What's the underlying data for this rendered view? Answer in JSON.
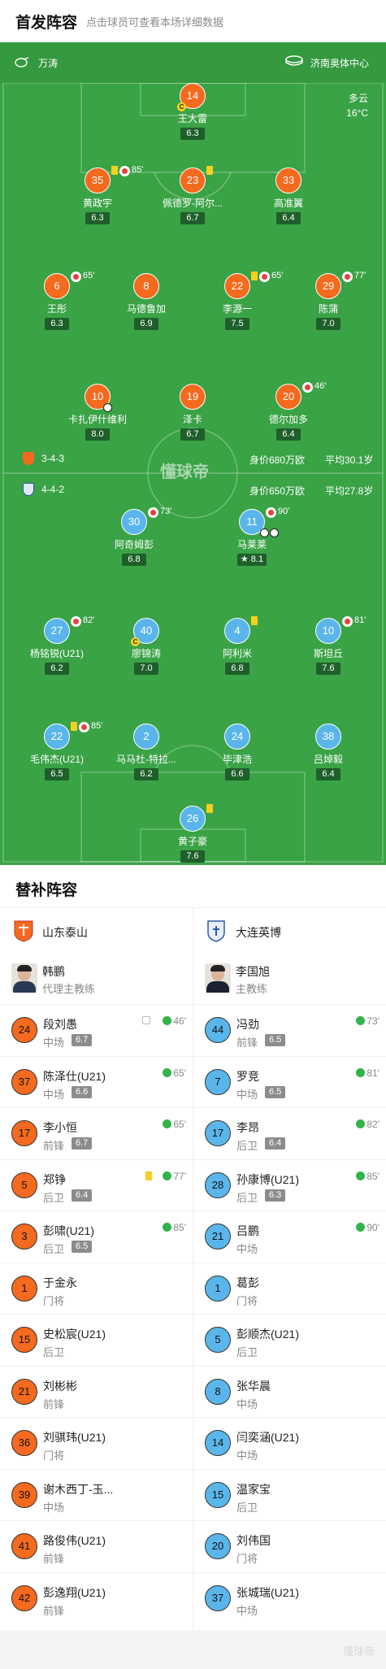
{
  "header": {
    "title": "首发阵容",
    "subtitle": "点击球员可查看本场详细数据"
  },
  "pitch_info": {
    "referee": "万涛",
    "venue": "济南奥体中心",
    "weather": "多云",
    "temperature": "16°C",
    "watermark": "懂球帝"
  },
  "home_team": {
    "name": "山东泰山",
    "formation": "3-4-3",
    "value": "身价680万欧",
    "avg_age": "平均30.1岁",
    "color": "#f46a1e"
  },
  "away_team": {
    "name": "大连英博",
    "formation": "4-4-2",
    "value": "身价650万欧",
    "avg_age": "平均27.8岁",
    "color": "#5ab6ea"
  },
  "home_lineup": [
    {
      "num": "14",
      "name": "王大雷",
      "rating": "6.3",
      "captain": true
    },
    {
      "num": "35",
      "name": "黄政宇",
      "rating": "6.3",
      "yellow": true,
      "sub_out": "85'"
    },
    {
      "num": "23",
      "name": "佩德罗-阿尔...",
      "rating": "6.7",
      "yellow": true
    },
    {
      "num": "33",
      "name": "高准翼",
      "rating": "6.4"
    },
    {
      "num": "6",
      "name": "王彤",
      "rating": "6.3",
      "sub_out": "65'"
    },
    {
      "num": "8",
      "name": "马德鲁加",
      "rating": "6.9"
    },
    {
      "num": "22",
      "name": "李源一",
      "rating": "7.5",
      "yellow": true,
      "sub_out": "65'"
    },
    {
      "num": "29",
      "name": "陈蒲",
      "rating": "7.0",
      "sub_out": "77'"
    },
    {
      "num": "10",
      "name": "卡扎伊什维利",
      "rating": "8.0",
      "goal": true
    },
    {
      "num": "19",
      "name": "泽卡",
      "rating": "6.7"
    },
    {
      "num": "20",
      "name": "德尔加多",
      "rating": "6.4",
      "sub_out": "46'"
    }
  ],
  "away_lineup": [
    {
      "num": "30",
      "name": "阿奇姆彭",
      "rating": "6.8",
      "sub_out": "73'"
    },
    {
      "num": "11",
      "name": "马莱莱",
      "rating": "8.1",
      "sub_out": "90'",
      "goals": 2,
      "star": true
    },
    {
      "num": "27",
      "name": "杨铭锐(U21)",
      "rating": "6.2",
      "sub_out": "82'"
    },
    {
      "num": "40",
      "name": "廖锦涛",
      "rating": "7.0",
      "captain": true
    },
    {
      "num": "4",
      "name": "阿利米",
      "rating": "6.8",
      "yellow": true
    },
    {
      "num": "10",
      "name": "斯坦丘",
      "rating": "7.6",
      "sub_out": "81'"
    },
    {
      "num": "22",
      "name": "毛伟杰(U21)",
      "rating": "6.5",
      "yellow": true,
      "sub_out": "85'"
    },
    {
      "num": "2",
      "name": "马马杜-特拉...",
      "rating": "6.2"
    },
    {
      "num": "24",
      "name": "毕津浩",
      "rating": "6.6"
    },
    {
      "num": "38",
      "name": "吕焯毅",
      "rating": "6.4"
    },
    {
      "num": "26",
      "name": "黄子豪",
      "rating": "7.6",
      "yellow": true
    }
  ],
  "subs": {
    "title": "替补阵容",
    "home": {
      "team": "山东泰山",
      "coach": {
        "name": "韩鹏",
        "role": "代理主教练"
      },
      "players": [
        {
          "num": "24",
          "name": "段刘愚",
          "pos": "中场",
          "rating": "6.7",
          "in": "46'",
          "boot": true
        },
        {
          "num": "37",
          "name": "陈泽仕(U21)",
          "pos": "中场",
          "rating": "6.6",
          "in": "65'"
        },
        {
          "num": "17",
          "name": "李小恒",
          "pos": "前锋",
          "rating": "6.7",
          "in": "65'"
        },
        {
          "num": "5",
          "name": "郑铮",
          "pos": "后卫",
          "rating": "6.4",
          "in": "77'",
          "yellow": true
        },
        {
          "num": "3",
          "name": "彭啸(U21)",
          "pos": "后卫",
          "rating": "6.5",
          "in": "85'"
        },
        {
          "num": "1",
          "name": "于金永",
          "pos": "门将"
        },
        {
          "num": "15",
          "name": "史松宸(U21)",
          "pos": "后卫"
        },
        {
          "num": "21",
          "name": "刘彬彬",
          "pos": "前锋"
        },
        {
          "num": "36",
          "name": "刘骐玮(U21)",
          "pos": "门将"
        },
        {
          "num": "39",
          "name": "谢木西丁-玉...",
          "pos": "中场"
        },
        {
          "num": "41",
          "name": "路俊伟(U21)",
          "pos": "前锋"
        },
        {
          "num": "42",
          "name": "彭逸翔(U21)",
          "pos": "前锋"
        }
      ]
    },
    "away": {
      "team": "大连英博",
      "coach": {
        "name": "李国旭",
        "role": "主教练"
      },
      "players": [
        {
          "num": "44",
          "name": "冯劲",
          "pos": "前锋",
          "rating": "6.5",
          "in": "73'"
        },
        {
          "num": "7",
          "name": "罗竞",
          "pos": "中场",
          "rating": "6.5",
          "in": "81'"
        },
        {
          "num": "17",
          "name": "李昂",
          "pos": "后卫",
          "rating": "6.4",
          "in": "82'"
        },
        {
          "num": "28",
          "name": "孙康博(U21)",
          "pos": "后卫",
          "rating": "6.3",
          "in": "85'"
        },
        {
          "num": "21",
          "name": "吕鹏",
          "pos": "中场",
          "in": "90'"
        },
        {
          "num": "1",
          "name": "葛彭",
          "pos": "门将"
        },
        {
          "num": "5",
          "name": "彭顺杰(U21)",
          "pos": "后卫"
        },
        {
          "num": "8",
          "name": "张华晨",
          "pos": "中场"
        },
        {
          "num": "14",
          "name": "闫奕涵(U21)",
          "pos": "中场"
        },
        {
          "num": "15",
          "name": "温家宝",
          "pos": "后卫"
        },
        {
          "num": "20",
          "name": "刘伟国",
          "pos": "门将"
        },
        {
          "num": "37",
          "name": "张城瑞(U21)",
          "pos": "中场"
        }
      ]
    }
  },
  "footer": {
    "watermark": "懂球帝"
  }
}
